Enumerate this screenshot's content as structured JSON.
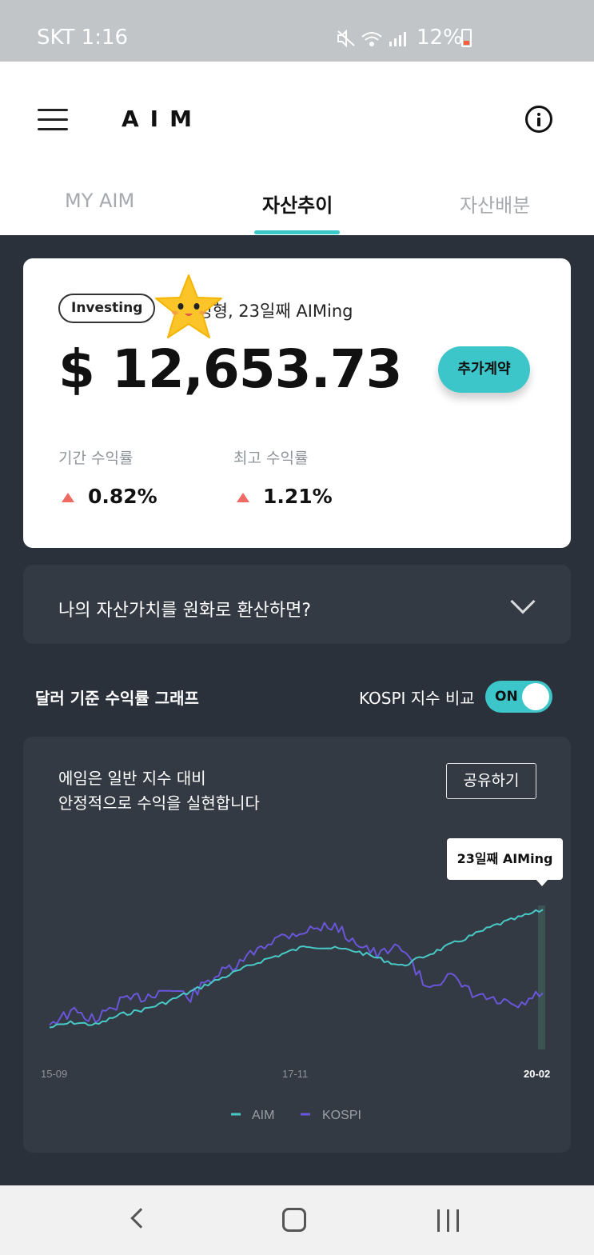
{
  "status_bar": {
    "carrier_time": "SKT 1:16",
    "battery_percent": "12%",
    "icons": [
      "mute-icon",
      "wifi-icon",
      "signal-icon",
      "battery-icon"
    ]
  },
  "header": {
    "logo": "AIM",
    "menu_icon": "hamburger-menu-icon",
    "info_icon": "info-icon"
  },
  "tabs": [
    {
      "label": "MY AIM",
      "active": false
    },
    {
      "label": "자산추이",
      "active": true
    },
    {
      "label": "자산배분",
      "active": false
    }
  ],
  "summary": {
    "badge": "Investing",
    "subline": "안정형, 23일째 AIMing",
    "amount": "$ 12,653.73",
    "add_contract_label": "추가계약",
    "stats": [
      {
        "label": "기간 수익률",
        "value": "0.82%"
      },
      {
        "label": "최고 수익률",
        "value": "1.21%"
      }
    ]
  },
  "convert": {
    "question": "나의 자산가치를 원화로 환산하면?"
  },
  "graph": {
    "title": "달러 기준 수익률 그래프",
    "kospi_toggle_label": "KOSPI 지수 비교",
    "toggle_state": "ON",
    "desc_line1": "에임은 일반 지수 대비",
    "desc_line2": "안정적으로 수익을 실현합니다",
    "share_label": "공유하기",
    "tooltip": "23일째 AIMing",
    "legend_aim": "AIM",
    "legend_kospi": "KOSPI",
    "colors": {
      "aim": "#48c9c6",
      "kospi": "#6a56d9"
    }
  },
  "chart_data": {
    "type": "line",
    "x_ticks": [
      "15-09",
      "17-11",
      "20-02"
    ],
    "series": [
      {
        "name": "AIM",
        "values": [
          12,
          14,
          13,
          17,
          19,
          22,
          26,
          30,
          34,
          38,
          41,
          44,
          43,
          42,
          39,
          36,
          40,
          44,
          48,
          52,
          55,
          58
        ]
      },
      {
        "name": "KOSPI",
        "values": [
          14,
          18,
          15,
          22,
          24,
          27,
          24,
          32,
          36,
          44,
          48,
          50,
          52,
          46,
          40,
          44,
          28,
          32,
          25,
          22,
          20,
          26
        ]
      }
    ]
  },
  "bottom_nav": {
    "icons": [
      "back-icon",
      "home-icon",
      "recent-apps-icon"
    ]
  }
}
